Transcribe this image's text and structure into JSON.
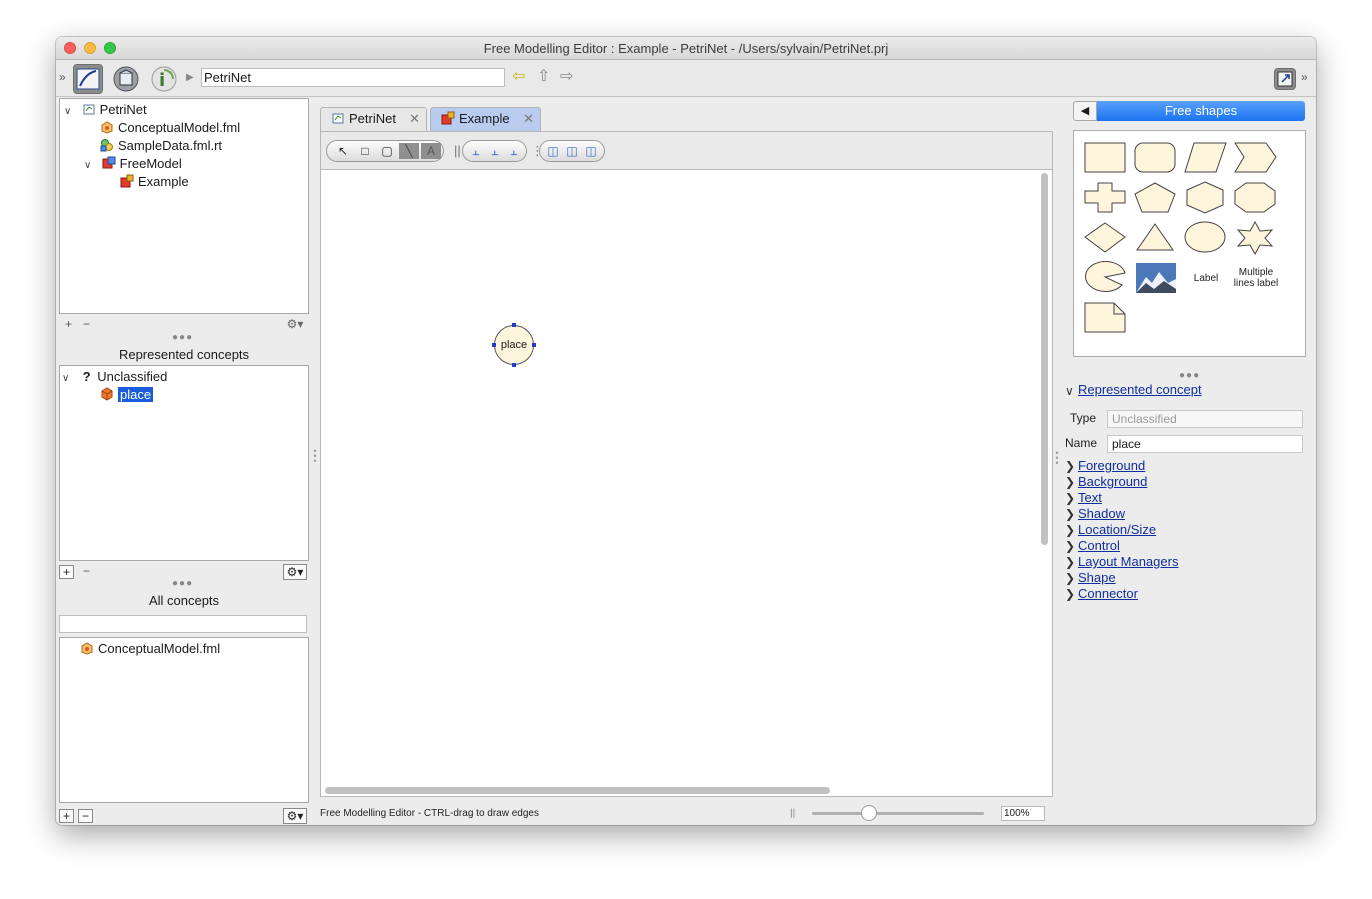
{
  "window": {
    "title": "Free Modelling Editor : Example - PetriNet - /Users/sylvain/PetriNet.prj"
  },
  "toolbar": {
    "project_field": "PetriNet"
  },
  "project_tree": {
    "items": [
      {
        "label": "PetriNet",
        "icon": "project-icon",
        "disclosure": "expanded"
      },
      {
        "label": "ConceptualModel.fml",
        "icon": "fml-icon"
      },
      {
        "label": "SampleData.fml.rt",
        "icon": "shapes-icon"
      },
      {
        "label": "FreeModel",
        "icon": "free-model-icon",
        "disclosure": "expanded"
      },
      {
        "label": "Example",
        "icon": "diagram-icon"
      }
    ]
  },
  "represented_concepts": {
    "title": "Represented concepts",
    "group": "Unclassified",
    "group_icon_glyph": "?",
    "item": "place"
  },
  "all_concepts": {
    "title": "All concepts",
    "search_value": "",
    "item": "ConceptualModel.fml"
  },
  "tabs": [
    {
      "label": "PetriNet",
      "active": false
    },
    {
      "label": "Example",
      "active": true
    }
  ],
  "canvas": {
    "node_label": "place"
  },
  "statusbar": {
    "message": "Free Modelling Editor - CTRL-drag to draw edges",
    "zoom": "100%",
    "zoom_fraction": 0.33
  },
  "right_panel": {
    "palette_title": "Free shapes",
    "shape_labels": {
      "label": "Label",
      "multiline_1": "Multiple",
      "multiline_2": "lines label"
    },
    "represented_concept_link": "Represented concept",
    "type_label": "Type",
    "type_value": "Unclassified",
    "name_label": "Name",
    "name_value": "place",
    "sections": [
      "Foreground",
      "Background",
      "Text",
      "Shadow",
      "Location/Size",
      "Control",
      "Layout Managers",
      "Shape",
      "Connector"
    ]
  },
  "colors": {
    "accent": "#1b73f0",
    "shape_fill": "#fff4dc",
    "selection": "#1a5ddb"
  }
}
